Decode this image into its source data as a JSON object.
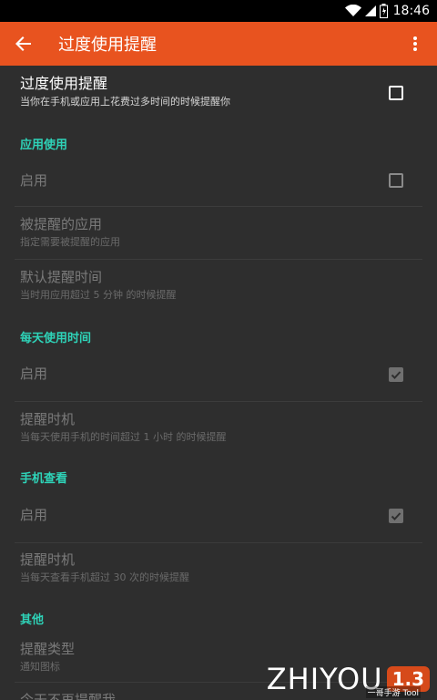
{
  "status_bar": {
    "time": "18:46",
    "icons": [
      "wifi-icon",
      "signal-icon",
      "battery-icon"
    ]
  },
  "app_bar": {
    "title": "过度使用提醒",
    "back_icon": "arrow-back-icon",
    "menu_icon": "more-vert-icon",
    "color": "#e8531f"
  },
  "main_pref": {
    "title": "过度使用提醒",
    "summary": "当你在手机或应用上花费过多时间的时候提醒你",
    "checked": false
  },
  "sections": {
    "app_usage": {
      "header": "应用使用",
      "enable": {
        "title": "启用",
        "checked": false
      },
      "apps": {
        "title": "被提醒的应用",
        "summary": "指定需要被提醒的应用"
      },
      "default_time": {
        "title": "默认提醒时间",
        "summary": "当时用应用超过 5 分钟 的时候提醒"
      }
    },
    "daily_usage": {
      "header": "每天使用时间",
      "enable": {
        "title": "启用",
        "checked": true
      },
      "timing": {
        "title": "提醒时机",
        "summary": "当每天使用手机的时间超过 1 小时 的时候提醒"
      }
    },
    "phone_check": {
      "header": "手机查看",
      "enable": {
        "title": "启用",
        "checked": true
      },
      "timing": {
        "title": "提醒时机",
        "summary": "当每天查看手机超过 30 次的时候提醒"
      }
    },
    "other": {
      "header": "其他",
      "type": {
        "title": "提醒类型",
        "summary": "通知图标"
      },
      "dont_remind": {
        "title": "今天不再提醒我"
      }
    }
  },
  "watermark": {
    "text": "ZHIYOU",
    "badge": "1.3",
    "sub": "一哥手游 Tool"
  },
  "colors": {
    "accent": "#2ed3b8",
    "background": "#2e2e2e"
  }
}
